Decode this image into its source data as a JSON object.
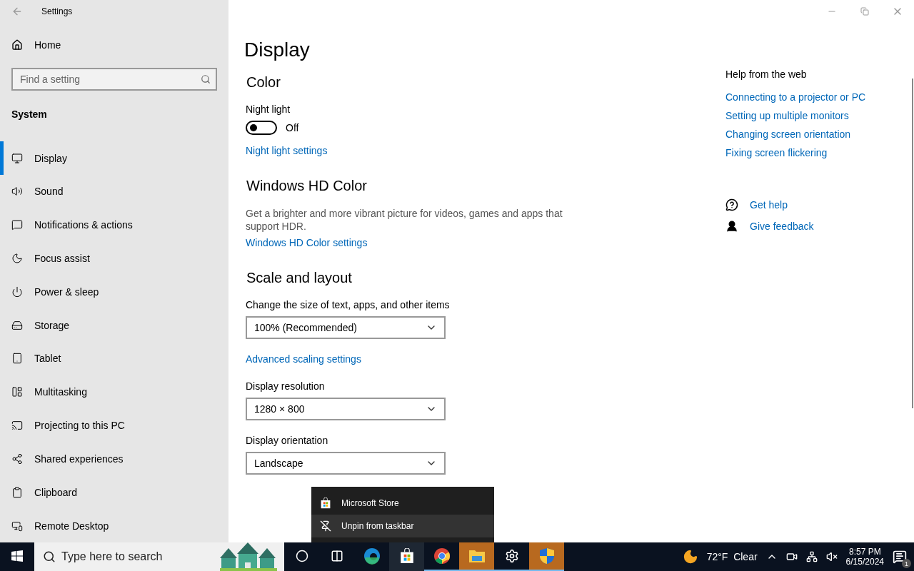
{
  "window": {
    "title": "Settings"
  },
  "sidebar": {
    "home": "Home",
    "search": {
      "placeholder": "Find a setting"
    },
    "section": "System",
    "items": [
      {
        "label": "Display",
        "selected": true
      },
      {
        "label": "Sound",
        "selected": false
      },
      {
        "label": "Notifications & actions",
        "selected": false
      },
      {
        "label": "Focus assist",
        "selected": false
      },
      {
        "label": "Power & sleep",
        "selected": false
      },
      {
        "label": "Storage",
        "selected": false
      },
      {
        "label": "Tablet",
        "selected": false
      },
      {
        "label": "Multitasking",
        "selected": false
      },
      {
        "label": "Projecting to this PC",
        "selected": false
      },
      {
        "label": "Shared experiences",
        "selected": false
      },
      {
        "label": "Clipboard",
        "selected": false
      },
      {
        "label": "Remote Desktop",
        "selected": false
      }
    ]
  },
  "page": {
    "title": "Display",
    "sections": [
      {
        "heading": "Color",
        "items": [
          {
            "kind": "label",
            "text": "Night light"
          },
          {
            "kind": "toggle",
            "on": false,
            "text": "Off"
          },
          {
            "kind": "link",
            "text": "Night light settings"
          }
        ]
      },
      {
        "heading": "Windows HD Color",
        "items": [
          {
            "kind": "paragraph",
            "text": "Get a brighter and more vibrant picture for videos, games and apps that support HDR."
          },
          {
            "kind": "link",
            "text": "Windows HD Color settings"
          }
        ]
      },
      {
        "heading": "Scale and layout",
        "items": [
          {
            "kind": "label",
            "text": "Change the size of text, apps, and other items"
          },
          {
            "kind": "dropdown",
            "text": "100% (Recommended)"
          },
          {
            "kind": "link",
            "text": "Advanced scaling settings"
          },
          {
            "kind": "label",
            "text": "Display resolution"
          },
          {
            "kind": "dropdown",
            "text": "1280 × 800"
          },
          {
            "kind": "label",
            "text": "Display orientation"
          },
          {
            "kind": "dropdown",
            "text": "Landscape"
          }
        ]
      }
    ]
  },
  "help": {
    "heading": "Help from the web",
    "links": [
      "Connecting to a projector or PC",
      "Setting up multiple monitors",
      "Changing screen orientation",
      "Fixing screen flickering"
    ],
    "actions": [
      "Get help",
      "Give feedback"
    ]
  },
  "context_menu": {
    "items": [
      {
        "label": "Microsoft Store",
        "selected": false
      },
      {
        "label": "Unpin from taskbar",
        "selected": true
      }
    ]
  },
  "taskbar": {
    "search": {
      "placeholder": "Type here to search"
    },
    "apps": [
      {
        "running": false,
        "hovered": false,
        "flashing": false
      },
      {
        "running": false,
        "hovered": false,
        "flashing": false
      },
      {
        "running": false,
        "hovered": false,
        "flashing": false
      },
      {
        "running": false,
        "hovered": true,
        "flashing": false
      },
      {
        "running": true,
        "hovered": false,
        "flashing": false
      },
      {
        "running": true,
        "hovered": false,
        "flashing": true
      },
      {
        "running": true,
        "hovered": false,
        "flashing": false
      },
      {
        "running": true,
        "hovered": false,
        "flashing": true
      }
    ],
    "weather": "72°F  Clear",
    "time": "8:57 PM",
    "date": "6/15/2024",
    "notifications": "1"
  }
}
